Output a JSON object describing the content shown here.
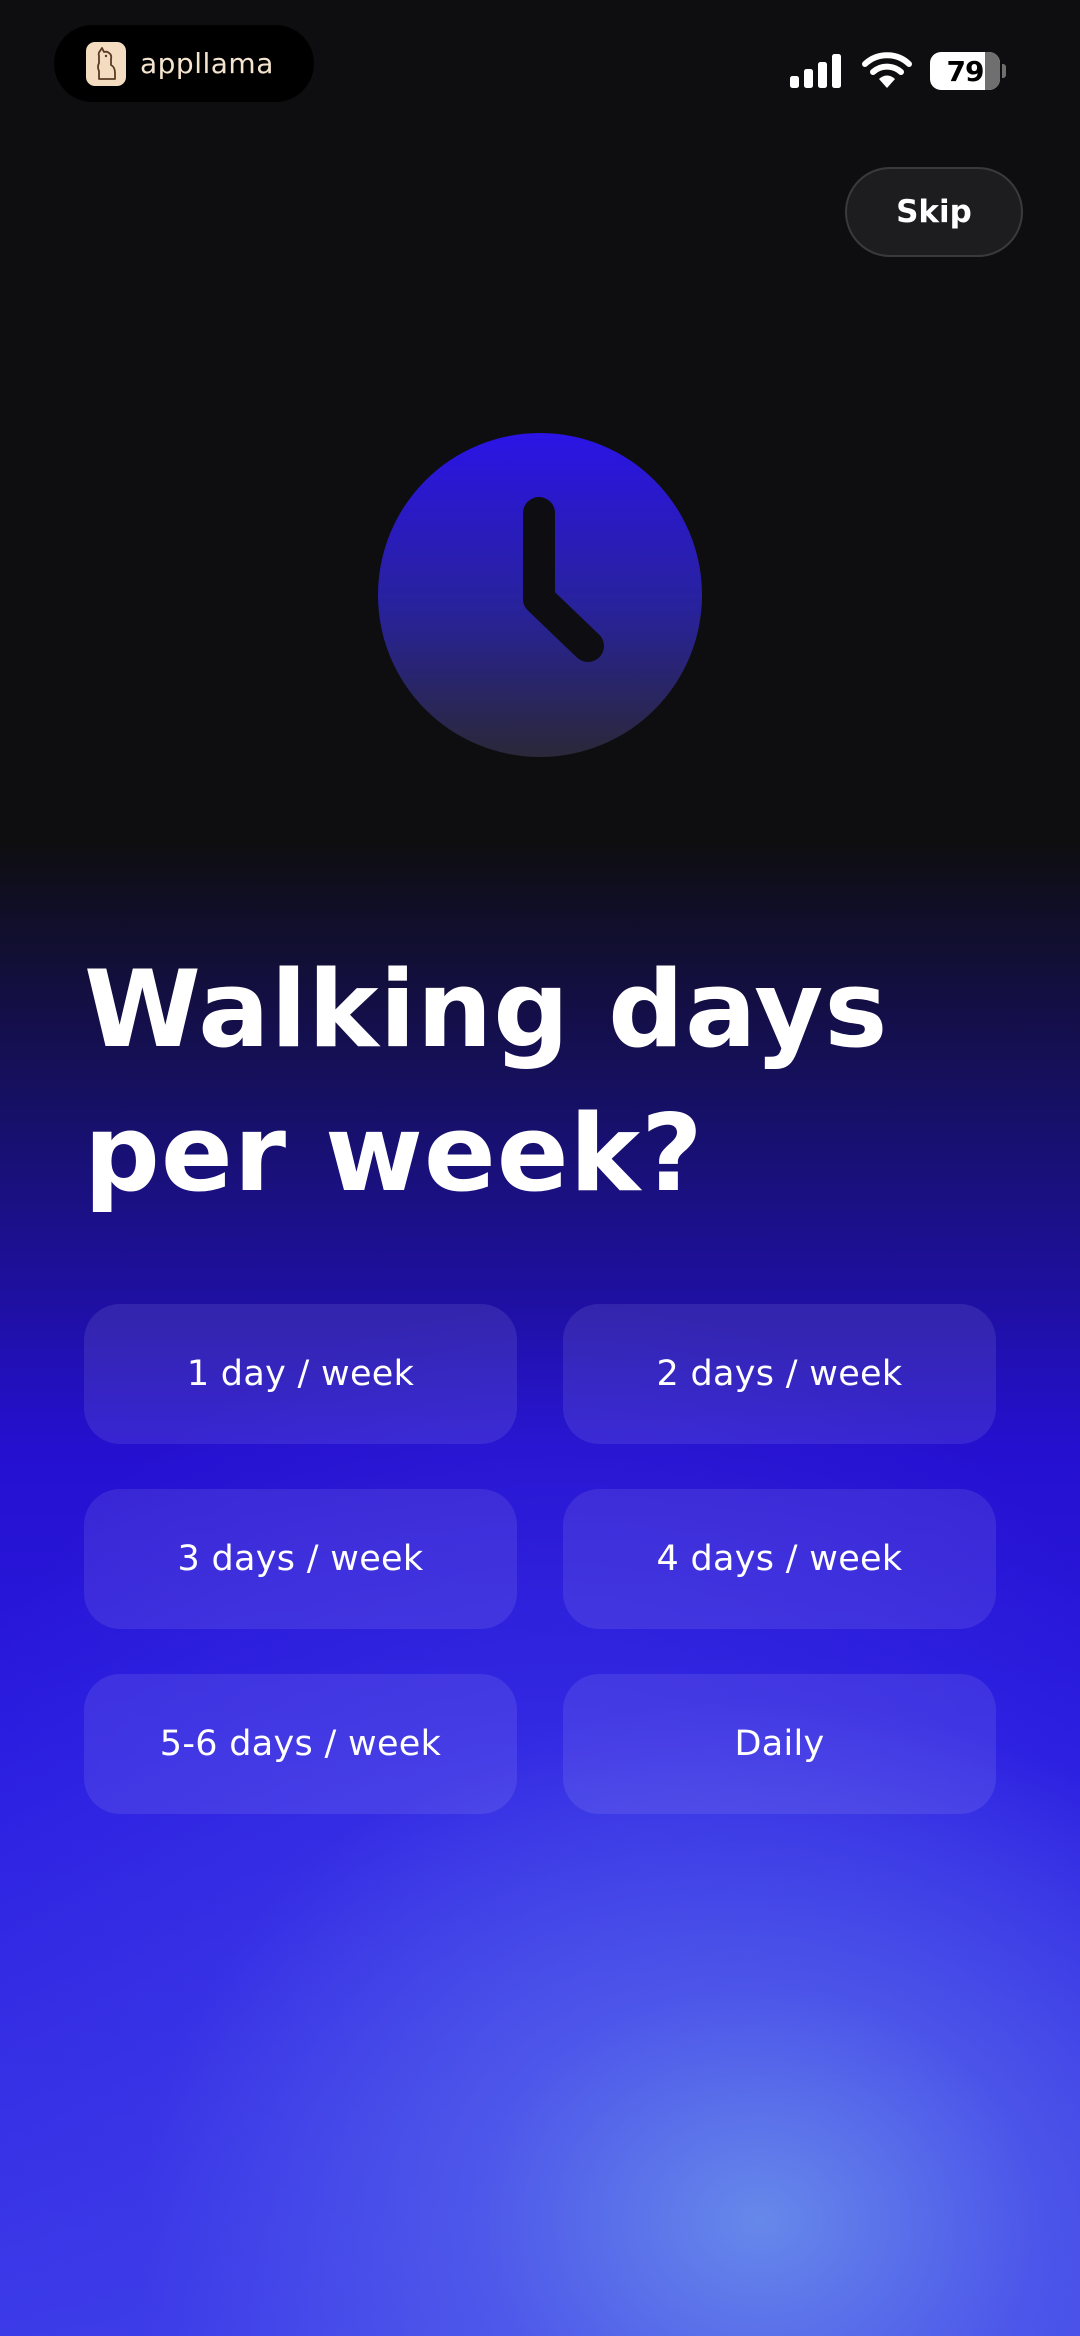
{
  "status_bar": {
    "app_name": "appllama",
    "battery_level": "79",
    "icons": [
      "llama-logo-icon",
      "cellular-signal-icon",
      "wifi-icon",
      "battery-icon"
    ]
  },
  "header": {
    "skip_label": "Skip"
  },
  "hero": {
    "icon": "clock-icon",
    "title_line1": "Walking days",
    "title_line2": "per week?"
  },
  "options": [
    {
      "label": "1 day / week"
    },
    {
      "label": "2 days / week"
    },
    {
      "label": "3 days / week"
    },
    {
      "label": "4 days / week"
    },
    {
      "label": "5-6 days / week"
    },
    {
      "label": "Daily"
    }
  ],
  "colors": {
    "background_top": "#0e0e10",
    "accent_blue": "#2a1ce0",
    "glow": "#5f86e8",
    "clock_top": "#2b14e6",
    "clock_bottom": "#2a2838",
    "text": "#ffffff"
  }
}
